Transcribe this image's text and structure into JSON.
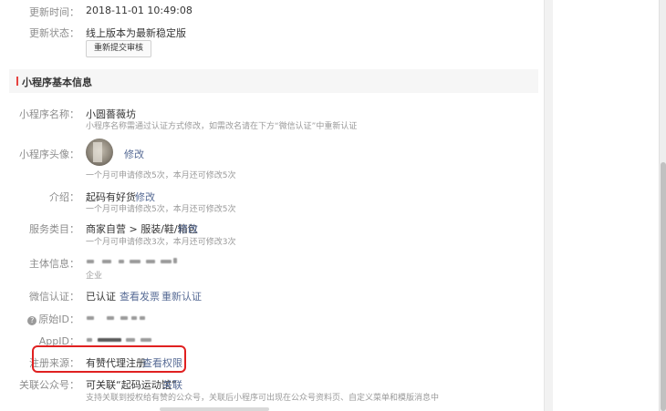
{
  "update": {
    "time_label": "更新时间：",
    "time_value": "2018-11-01 10:49:08",
    "status_label": "更新状态：",
    "status_value": "线上版本为最新稳定版",
    "resubmit_button": "重新提交审核"
  },
  "section": {
    "title": "小程序基本信息"
  },
  "info": {
    "name_label": "小程序名称：",
    "name_value": "小圆薔薇坊",
    "name_tip": "小程序名称需通过认证方式修改，如需改名请在下方“微信认证”中重新认证",
    "avatar_label": "小程序头像：",
    "avatar_link": "修改",
    "avatar_tip": "一个月可申请修改5次，本月还可修改5次",
    "intro_label": "介绍：",
    "intro_value": "起码有好货",
    "intro_link": "修改",
    "intro_tip": "一个月可申请修改5次，本月还可修改5次",
    "category_label": "服务类目：",
    "category_value": "商家自营 > 服装/鞋/箱包",
    "category_link": "修改",
    "category_tip": "一个月可申请修改3次，本月还可修改3次",
    "entity_label": "主体信息：",
    "entity_tip": "企业",
    "verify_label": "微信认证：",
    "verify_value": "已认证",
    "verify_link_invoice": "查看发票",
    "verify_link_reverify": "重新认证",
    "origin_id_label": "原始ID：",
    "appid_label": "AppID：",
    "source_label": "注册来源：",
    "source_value": "有赞代理注册",
    "source_link": "查看权限",
    "linked_label": "关联公众号：",
    "linked_value": "可关联“起码运动馆”",
    "linked_link": "关联",
    "linked_tip": "支持关联到授权给有赞的公众号，关联后小程序可出现在公众号资料页、自定义菜单和模版消息中"
  },
  "colors": {
    "link": "#576b95",
    "highlight": "#e02020",
    "section_accent": "#e64340"
  }
}
